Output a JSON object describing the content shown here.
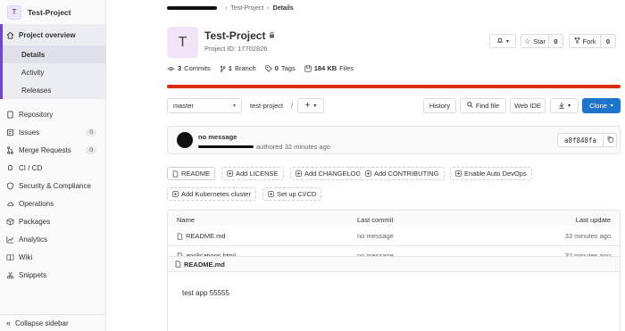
{
  "sidebar": {
    "project_initial": "T",
    "project_name": "Test-Project",
    "overview": "Project overview",
    "sub_items": [
      "Details",
      "Activity",
      "Releases"
    ],
    "items": [
      {
        "label": "Repository",
        "icon": "book-icon"
      },
      {
        "label": "Issues",
        "icon": "issues-icon",
        "badge": "0"
      },
      {
        "label": "Merge Requests",
        "icon": "merge-request-icon",
        "badge": "0"
      },
      {
        "label": "CI / CD",
        "icon": "rocket-icon"
      },
      {
        "label": "Security & Compliance",
        "icon": "shield-icon"
      },
      {
        "label": "Operations",
        "icon": "cloud-gear-icon"
      },
      {
        "label": "Packages",
        "icon": "package-icon"
      },
      {
        "label": "Analytics",
        "icon": "chart-icon"
      },
      {
        "label": "Wiki",
        "icon": "book-open-icon"
      },
      {
        "label": "Snippets",
        "icon": "snippet-icon"
      }
    ],
    "collapse": "Collapse sidebar"
  },
  "breadcrumb": {
    "items": [
      "Test-Project",
      "Details"
    ]
  },
  "project": {
    "initial": "T",
    "name": "Test-Project",
    "id_text": "Project ID: 17702826",
    "notify_icon": "bell-icon",
    "star_label": "Star",
    "star_count": "0",
    "fork_label": "Fork",
    "fork_count": "0"
  },
  "stats": {
    "commits_num": "3",
    "commits_label": "Commits",
    "branch_num": "1",
    "branch_label": "Branch",
    "tags_num": "0",
    "tags_label": "Tags",
    "files_size": "184 KB",
    "files_label": "Files"
  },
  "storage_bar": {
    "color": "#dd2b0e",
    "fill_fraction": 1.0
  },
  "repo_nav": {
    "branch": "master",
    "path": "test-project",
    "path_sep": "/",
    "add_label": "+",
    "history": "History",
    "find_file": "Find file",
    "web_ide": "Web IDE",
    "clone": "Clone"
  },
  "commit": {
    "message": "no message",
    "authored": "authored 32 minutes ago",
    "sha": "a8f848fa"
  },
  "quick_actions": {
    "readme": "README",
    "add_license": "Add LICENSE",
    "add_changelog": "Add CHANGELOG",
    "add_contributing": "Add CONTRIBUTING",
    "auto_devops": "Enable Auto DevOps",
    "k8s": "Add Kubernetes cluster",
    "cicd": "Set up CI/CD"
  },
  "file_table": {
    "headers": [
      "Name",
      "Last commit",
      "Last update"
    ],
    "rows": [
      {
        "name": "README.md",
        "commit": "no message",
        "updated": "33 minutes ago"
      },
      {
        "name": "applications.html",
        "commit": "no message",
        "updated": "32 minutes ago"
      }
    ]
  },
  "readme": {
    "title": "README.md",
    "content": "test app 55555"
  },
  "colors": {
    "accent": "#6e49cb",
    "clone_button": "#1f75cb",
    "storage_warning": "#dd2b0e"
  }
}
